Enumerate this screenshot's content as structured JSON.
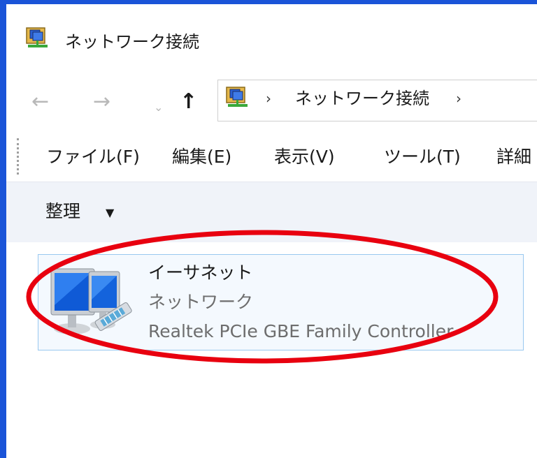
{
  "window": {
    "title": "ネットワーク接続",
    "border_color": "#1a54d8",
    "title_icon": "network-connections-icon"
  },
  "navigation": {
    "back_icon": "←",
    "forward_icon": "→",
    "recent_icon": "⌄",
    "up_icon": "↑",
    "address_separator_1": "›",
    "address_path": "ネットワーク接続",
    "address_separator_2": "›"
  },
  "menu": {
    "items": [
      "ファイル(F)",
      "編集(E)",
      "表示(V)",
      "ツール(T)",
      "詳細"
    ]
  },
  "command_bar": {
    "organize_label": "整理",
    "organize_arrow": "▼"
  },
  "adapters": [
    {
      "name": "イーサネット",
      "status": "ネットワーク",
      "device": "Realtek PCIe GBE Family Controller",
      "icon": "ethernet-adapter-icon",
      "selected": true
    }
  ],
  "annotation": {
    "shape": "ellipse",
    "color": "#e8000f"
  }
}
